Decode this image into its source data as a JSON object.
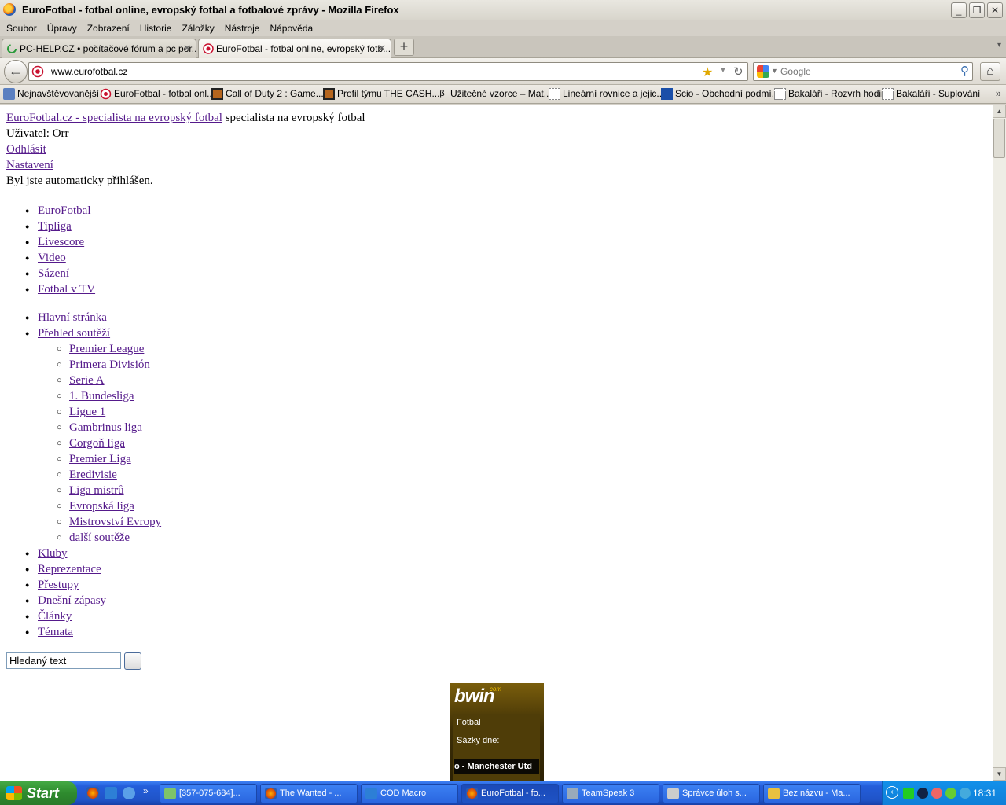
{
  "window": {
    "title": "EuroFotbal - fotbal online, evropský fotbal a fotbalové zprávy - Mozilla Firefox",
    "controls": {
      "minimize": "_",
      "maximize": "❐",
      "close": "✕"
    }
  },
  "menubar": [
    "Soubor",
    "Úpravy",
    "Zobrazení",
    "Historie",
    "Záložky",
    "Nástroje",
    "Nápověda"
  ],
  "tabs": [
    {
      "label": "PC-HELP.CZ • počítačové fórum a pc por...",
      "active": false
    },
    {
      "label": "EuroFotbal - fotbal online, evropský fotb...",
      "active": true
    }
  ],
  "navbar": {
    "url": "www.eurofotbal.cz",
    "search_placeholder": "Google"
  },
  "bookmarks": [
    "Nejnavštěvovanější",
    "EuroFotbal - fotbal onl...",
    "Call of Duty 2 : Game...",
    "Profil týmu THE CASH...",
    "Užitečné vzorce – Mat...",
    "Lineární rovnice a jejic...",
    "Scio - Obchodní podmí...",
    "Bakaláři - Rozvrh hodin",
    "Bakaláři - Suplování"
  ],
  "page": {
    "site_link": "EuroFotbal.cz - specialista na evropský fotbal",
    "tagline": " specialista na evropský fotbal",
    "user_label": "Uživatel: Orr",
    "logout": "Odhlásit",
    "settings": "Nastavení",
    "auto_login": "Byl jste automaticky přihlášen.",
    "top_menu": [
      "EuroFotbal",
      "Tipliga",
      "Livescore",
      "Video",
      "Sázení",
      "Fotbal v TV"
    ],
    "main_menu": {
      "home": "Hlavní stránka",
      "competitions": "Přehled soutěží",
      "competition_items": [
        "Premier League",
        "Primera División",
        "Serie A",
        "1. Bundesliga",
        "Ligue 1",
        "Gambrinus liga",
        "Corgoň liga",
        "Premier Liga",
        "Eredivisie",
        "Liga mistrů",
        "Evropská liga",
        "Mistrovství Evropy",
        "další soutěže"
      ],
      "rest": [
        "Kluby",
        "Reprezentace",
        "Přestupy",
        "Dnešní zápasy",
        "Články",
        "Témata"
      ]
    },
    "search_value": "Hledaný text",
    "ad": {
      "brand": "bwin",
      "brand_suffix": "com",
      "label1": "Fotbal",
      "label2": "Sázky dne:",
      "match": "o - Manchester Utd"
    }
  },
  "taskbar": {
    "start": "Start",
    "tasks": [
      {
        "label": "[357-075-684]...",
        "active": false
      },
      {
        "label": "The Wanted - ...",
        "active": false
      },
      {
        "label": "COD Macro",
        "active": false
      },
      {
        "label": "EuroFotbal - fo...",
        "active": true
      },
      {
        "label": "TeamSpeak 3",
        "active": false
      },
      {
        "label": "Správce úloh s...",
        "active": false
      },
      {
        "label": "Bez názvu - Ma...",
        "active": false
      }
    ],
    "clock": "18:31"
  }
}
